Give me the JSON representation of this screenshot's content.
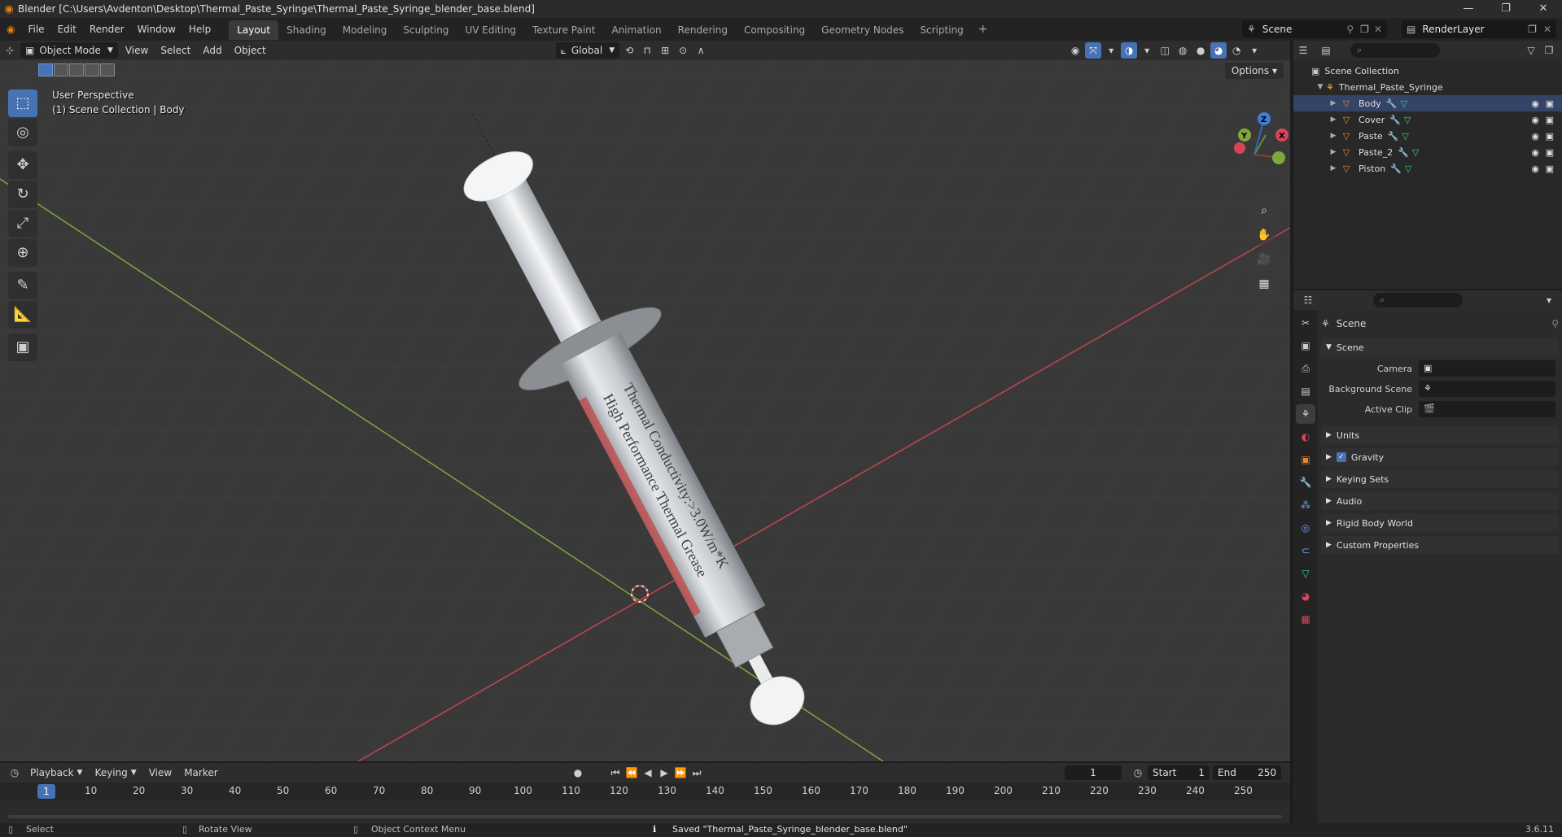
{
  "window": {
    "title": "Blender [C:\\Users\\Avdenton\\Desktop\\Thermal_Paste_Syringe\\Thermal_Paste_Syringe_blender_base.blend]"
  },
  "menu": {
    "items": [
      "File",
      "Edit",
      "Render",
      "Window",
      "Help"
    ],
    "workspaces": [
      "Layout",
      "Shading",
      "Modeling",
      "Sculpting",
      "UV Editing",
      "Texture Paint",
      "Animation",
      "Rendering",
      "Compositing",
      "Geometry Nodes",
      "Scripting"
    ],
    "active_workspace": "Layout",
    "scene": "Scene",
    "view_layer": "RenderLayer"
  },
  "viewport": {
    "mode": "Object Mode",
    "menus": [
      "View",
      "Select",
      "Add",
      "Object"
    ],
    "orientation": "Global",
    "options_label": "Options",
    "perspective": "User Perspective",
    "context": "(1) Scene Collection | Body",
    "label_text_1": "High Performance Thermal Grease",
    "label_text_2": "Thermal Conductivity:>3.0W/m*K",
    "gizmo_axes": [
      "X",
      "Y",
      "Z"
    ]
  },
  "outliner": {
    "root": "Scene Collection",
    "collection": "Thermal_Paste_Syringe",
    "objects": [
      "Body",
      "Cover",
      "Paste",
      "Paste_2",
      "Piston"
    ]
  },
  "properties": {
    "title": "Scene",
    "section": "Scene",
    "fields": [
      {
        "label": "Camera",
        "value": ""
      },
      {
        "label": "Background Scene",
        "value": ""
      },
      {
        "label": "Active Clip",
        "value": ""
      }
    ],
    "panels": [
      "Units",
      "Gravity",
      "Keying Sets",
      "Audio",
      "Rigid Body World",
      "Custom Properties"
    ],
    "gravity_checked": true
  },
  "timeline": {
    "menus": [
      "Playback",
      "Keying",
      "View",
      "Marker"
    ],
    "current_frame": "1",
    "start_label": "Start",
    "start": "1",
    "end_label": "End",
    "end": "250",
    "ticks": [
      "10",
      "20",
      "30",
      "40",
      "50",
      "60",
      "70",
      "80",
      "90",
      "100",
      "110",
      "120",
      "130",
      "140",
      "150",
      "160",
      "170",
      "180",
      "190",
      "200",
      "210",
      "220",
      "230",
      "240",
      "250"
    ]
  },
  "status": {
    "select": "Select",
    "rotate": "Rotate View",
    "context_menu": "Object Context Menu",
    "message": "Saved \"Thermal_Paste_Syringe_blender_base.blend\"",
    "version": "3.6.11"
  },
  "colors": {
    "accent": "#4772b3",
    "x_axis": "#d8455a",
    "y_axis": "#7fa83a",
    "z_axis": "#3f7fd6",
    "object": "#e88a2e",
    "mesh": "#3fd27e"
  }
}
